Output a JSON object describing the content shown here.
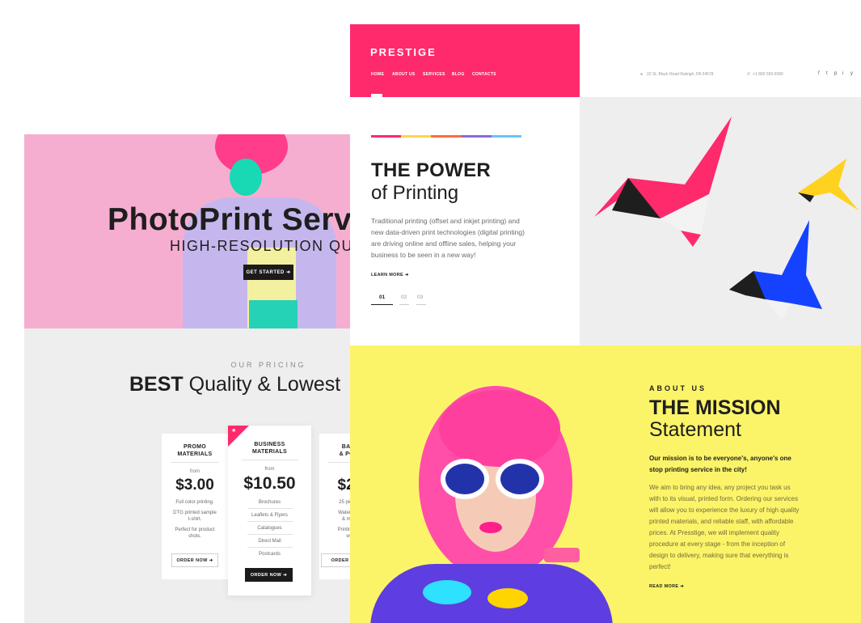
{
  "back_preview": {
    "hero": {
      "title": "PhotoPrint Serv",
      "subtitle": "HIGH-RESOLUTION QUALI",
      "button": "GET STARTED ➜"
    },
    "pricing": {
      "eyebrow": "OUR PRICING",
      "title_bold": "BEST",
      "title_rest": " Quality & Lowest",
      "cards": [
        {
          "name_line1": "PROMO",
          "name_line2": "MATERIALS",
          "from": "from",
          "price": "$3.00",
          "features": [
            "Full color printing.",
            "DTG printed sample",
            "t-shirt.",
            "Perfect for product",
            "shots."
          ],
          "button": "ORDER NOW ➜"
        },
        {
          "name_line1": "BUSINESS",
          "name_line2": "MATERIALS",
          "from": "from",
          "price": "$10.50",
          "features": [
            "Brochures",
            "Leaflets & Flyers",
            "Catalogues",
            "Direct Mail",
            "Postcards"
          ],
          "button": "ORDER NOW ➜",
          "badge": "★"
        },
        {
          "name_line1": "BANNE",
          "name_line2": "& POSTE",
          "from": "fro",
          "price": "$2.7",
          "features": [
            "25 pieces mi",
            "Water-based,",
            "& metallic",
            "Printing 10,00",
            "weekl"
          ],
          "button": "ORDER NO"
        }
      ]
    }
  },
  "front_preview": {
    "logo": "PRESTIGE",
    "nav": [
      "HOME",
      "ABOUT US",
      "SERVICES",
      "BLOG",
      "CONTACTS"
    ],
    "address": "22 St. Black Road Raleigh, PA 34578",
    "phone": "+1 800 559 6580",
    "social_icons": [
      "f",
      "t",
      "p",
      "i",
      "y"
    ],
    "slide": {
      "title_line1": "THE POWER",
      "title_line2": "of Printing",
      "text": "Traditional printing (offset and inkjet printing) and new data-driven print technologies (digital printing) are driving online and offline sales, helping your business to be seen in a new way!",
      "link": "LEARN MORE ➜",
      "pages": [
        "01",
        "02",
        "03"
      ],
      "bar_colors": [
        "#ff2a6b",
        "#ffd54a",
        "#ff6a3d",
        "#8a6ad8",
        "#6ac2ff"
      ]
    },
    "mission": {
      "eyebrow": "ABOUT US",
      "title_line1": "THE MISSION",
      "title_line2": "Statement",
      "lead": "Our mission is to be everyone's, anyone's one stop printing service in the city!",
      "body": "We aim to bring any idea, any project you task us with to its visual, printed form. Ordering our services will allow you to experience the luxury of high quality printed materials, and reliable staff, with affordable prices. At Presstige, we will implement quality procedure at every stage - from the inception of design to delivery, making sure that everything is perfect!",
      "link": "READ MORE ➜"
    }
  },
  "colors": {
    "accent": "#ff2a6b",
    "yellow": "#fcf468",
    "pink_hero": "#f6aed0"
  }
}
